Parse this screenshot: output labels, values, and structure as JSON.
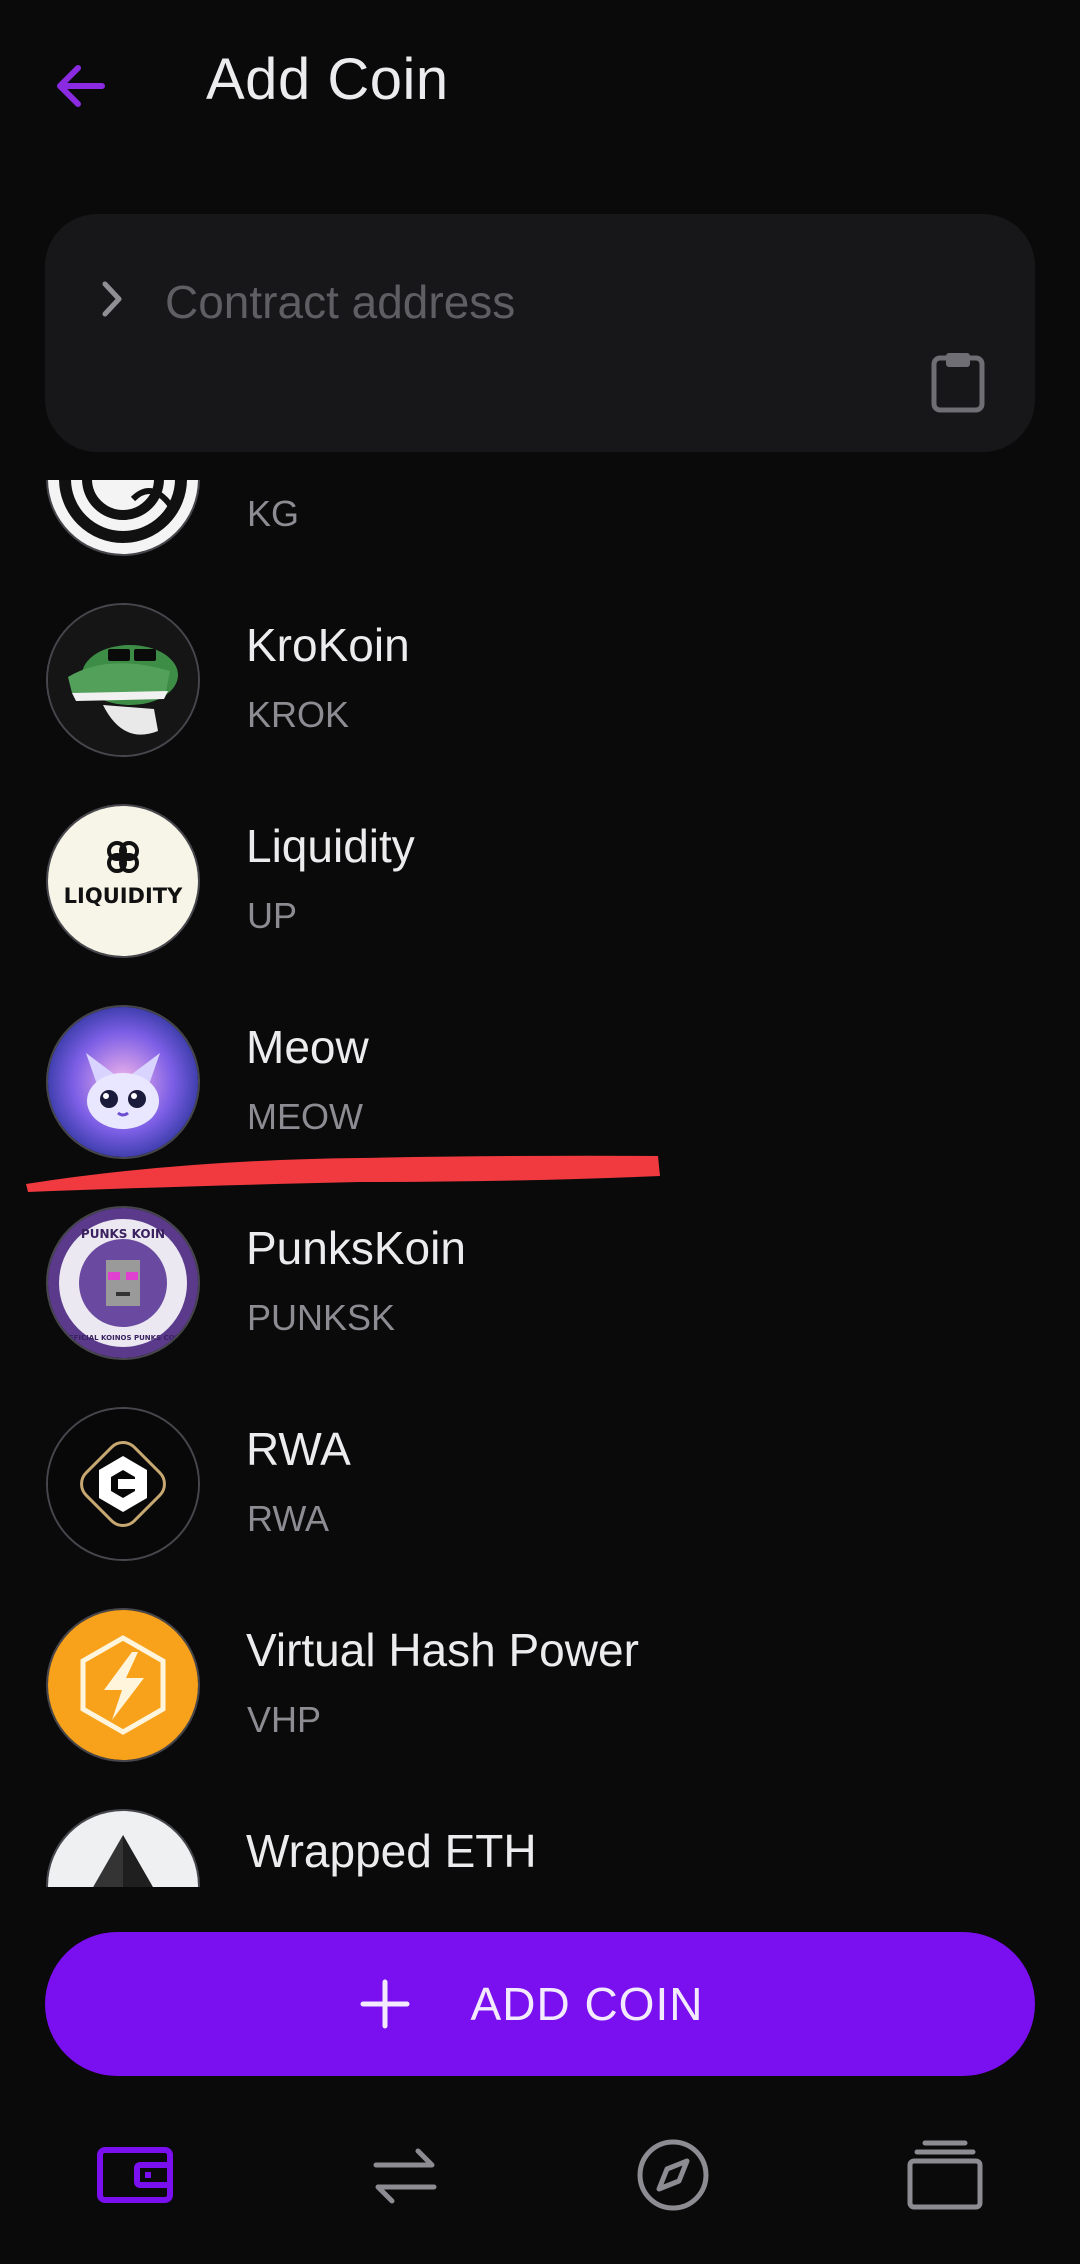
{
  "header": {
    "title": "Add Coin"
  },
  "contract": {
    "placeholder": "Contract address"
  },
  "coins": [
    {
      "name": "",
      "symbol": "KG",
      "icon": "kg-coin-icon"
    },
    {
      "name": "KroKoin",
      "symbol": "KROK",
      "icon": "krokoin-crocodile-icon"
    },
    {
      "name": "Liquidity",
      "symbol": "UP",
      "icon": "liquidity-logo-icon",
      "icon_text": "LIQUIDITY"
    },
    {
      "name": "Meow",
      "symbol": "MEOW",
      "icon": "meow-cat-icon"
    },
    {
      "name": "PunksKoin",
      "symbol": "PUNKSK",
      "icon": "punkskoin-badge-icon",
      "icon_text": "PUNKS KOIN",
      "icon_subtext": "OFFICIAL KOINOS PUNKS COIN"
    },
    {
      "name": "RWA",
      "symbol": "RWA",
      "icon": "rwa-hexagon-icon"
    },
    {
      "name": "Virtual Hash Power",
      "symbol": "VHP",
      "icon": "vhp-lightning-icon"
    },
    {
      "name": "Wrapped ETH",
      "symbol": "",
      "icon": "eth-diamond-icon"
    }
  ],
  "actions": {
    "add_coin_label": "ADD COIN"
  },
  "colors": {
    "accent": "#7a0ff0",
    "background": "#0a0a0b",
    "annotation": "#f03a3f"
  },
  "nav": {
    "items": [
      "wallet-icon",
      "swap-icon",
      "explore-compass-icon",
      "stack-icon"
    ],
    "active_index": 0
  }
}
